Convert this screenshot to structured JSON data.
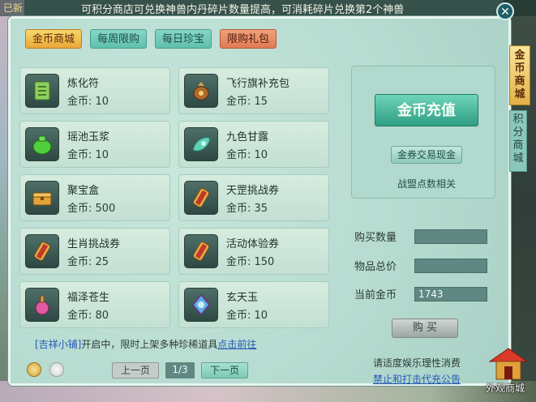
{
  "notice": {
    "left_text": "已新",
    "text": "可积分商店可兑换神兽内丹碎片数量提高，可消耗碎片兑换第2个神兽"
  },
  "tabs": [
    {
      "label": "金币商城",
      "state": "active"
    },
    {
      "label": "每周限购",
      "state": "normal"
    },
    {
      "label": "每日珍宝",
      "state": "normal"
    },
    {
      "label": "限购礼包",
      "state": "gift"
    }
  ],
  "items": [
    {
      "name": "炼化符",
      "price": "金币: 10",
      "icon": "talisman-icon"
    },
    {
      "name": "飞行旗补充包",
      "price": "金币: 15",
      "icon": "flag-pack-icon"
    },
    {
      "name": "瑶池玉浆",
      "price": "金币: 10",
      "icon": "green-jar-icon"
    },
    {
      "name": "九色甘露",
      "price": "金币: 10",
      "icon": "dew-leaf-icon"
    },
    {
      "name": "聚宝盒",
      "price": "金币: 500",
      "icon": "treasure-box-icon"
    },
    {
      "name": "天罡挑战券",
      "price": "金币: 35",
      "icon": "scroll-icon"
    },
    {
      "name": "生肖挑战券",
      "price": "金币: 25",
      "icon": "scroll-icon"
    },
    {
      "name": "活动体验券",
      "price": "金币: 150",
      "icon": "scroll-icon"
    },
    {
      "name": "福泽苍生",
      "price": "金币: 80",
      "icon": "potion-icon"
    },
    {
      "name": "玄天玉",
      "price": "金币: 10",
      "icon": "jade-icon"
    }
  ],
  "right": {
    "recharge_label": "金币充值",
    "exchange_label": "金券交易现金",
    "alliance_label": "战盟点数相关",
    "buy_qty_label": "购买数量",
    "total_label": "物品总价",
    "current_label": "当前金币",
    "current_value": "1743",
    "buy_label": "购 买"
  },
  "promo": {
    "bracket": "[吉祥小铺]",
    "text": "开启中，限时上架多种珍稀道具",
    "link": "点击前往"
  },
  "pager": {
    "prev": "上一页",
    "page": "1/3",
    "next": "下一页"
  },
  "footer": {
    "line1": "请适度娱乐理性消费",
    "line2": "禁止和打击代充公告"
  },
  "side": {
    "tab1": "金币商城",
    "tab2": "积分商城",
    "outfit_label": "外观商城"
  },
  "colors": {
    "panel": "#b9dcd2",
    "active_tab": "#eaa63a",
    "recharge": "#2f9e84",
    "link": "#2457b8"
  }
}
